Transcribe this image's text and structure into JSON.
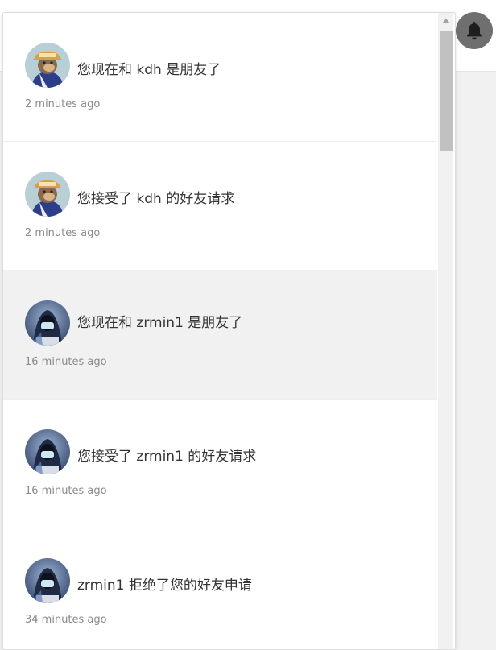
{
  "header": {
    "bell_icon": "bell-icon"
  },
  "notifications": [
    {
      "avatar": "ape-avatar",
      "message": "您现在和 kdh 是朋友了",
      "time": "2 minutes ago",
      "unread": false
    },
    {
      "avatar": "ape-avatar",
      "message": "您接受了 kdh 的好友请求",
      "time": "2 minutes ago",
      "unread": false
    },
    {
      "avatar": "hooded-avatar",
      "message": "您现在和 zrmin1 是朋友了",
      "time": "16 minutes ago",
      "unread": true
    },
    {
      "avatar": "hooded-avatar",
      "message": "您接受了 zrmin1 的好友请求",
      "time": "16 minutes ago",
      "unread": false
    },
    {
      "avatar": "hooded-avatar",
      "message": "zrmin1 拒绝了您的好友申请",
      "time": "34 minutes ago",
      "unread": false
    }
  ],
  "colors": {
    "unread_bg": "#f1f1f1",
    "bell_bg": "#6f6f6f"
  }
}
